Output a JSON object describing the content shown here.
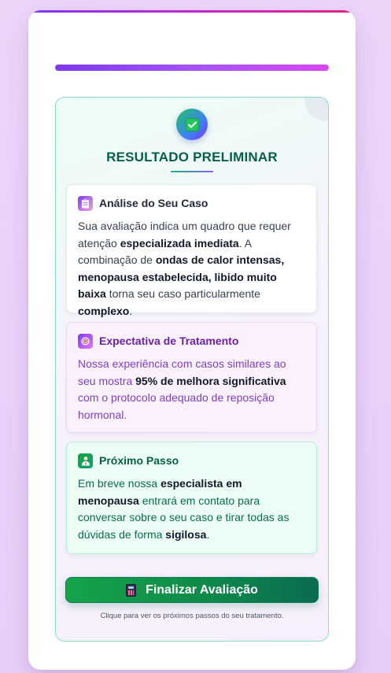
{
  "progress": {
    "percent": 100
  },
  "result": {
    "title": "RESULTADO PRELIMINAR",
    "badge_icon": "check-mark-icon"
  },
  "cards": {
    "analysis": {
      "icon": "clipboard-icon",
      "title": "Análise do Seu Caso",
      "body": [
        {
          "t": "Sua avaliação indica um quadro que requer atenção ",
          "b": false
        },
        {
          "t": "especializada imediata",
          "b": true
        },
        {
          "t": ". A combinação de ",
          "b": false
        },
        {
          "t": "ondas de calor intensas, menopausa estabelecida, libido muito baixa",
          "b": true
        },
        {
          "t": " torna seu caso particularmente ",
          "b": false
        },
        {
          "t": "complexo",
          "b": true
        },
        {
          "t": ".",
          "b": false
        }
      ]
    },
    "expectation": {
      "icon": "target-icon",
      "title": "Expectativa de Tratamento",
      "body": [
        {
          "t": "Nossa experiência com casos similares ao seu mostra ",
          "b": false
        },
        {
          "t": "95% de melhora significativa",
          "b": true
        },
        {
          "t": " com o protocolo adequado de reposição hormonal.",
          "b": false
        }
      ]
    },
    "next_step": {
      "icon": "doctor-icon",
      "title": "Próximo Passo",
      "body": [
        {
          "t": "Em breve nossa ",
          "b": false
        },
        {
          "t": "especialista em menopausa",
          "b": true
        },
        {
          "t": " entrará em contato para conversar sobre o seu caso e tirar todas as dúvidas de forma ",
          "b": false
        },
        {
          "t": "sigilosa",
          "b": true
        },
        {
          "t": ".",
          "b": false
        }
      ]
    }
  },
  "finalize": {
    "icon": "calculator-icon",
    "label": "Finalizar Avaliação",
    "hint": "Clique para ver os próximos passos do seu tratamento."
  },
  "colors": {
    "accent_purple": "#7c3aed",
    "accent_green": "#16a34a",
    "title_green": "#065f46"
  }
}
